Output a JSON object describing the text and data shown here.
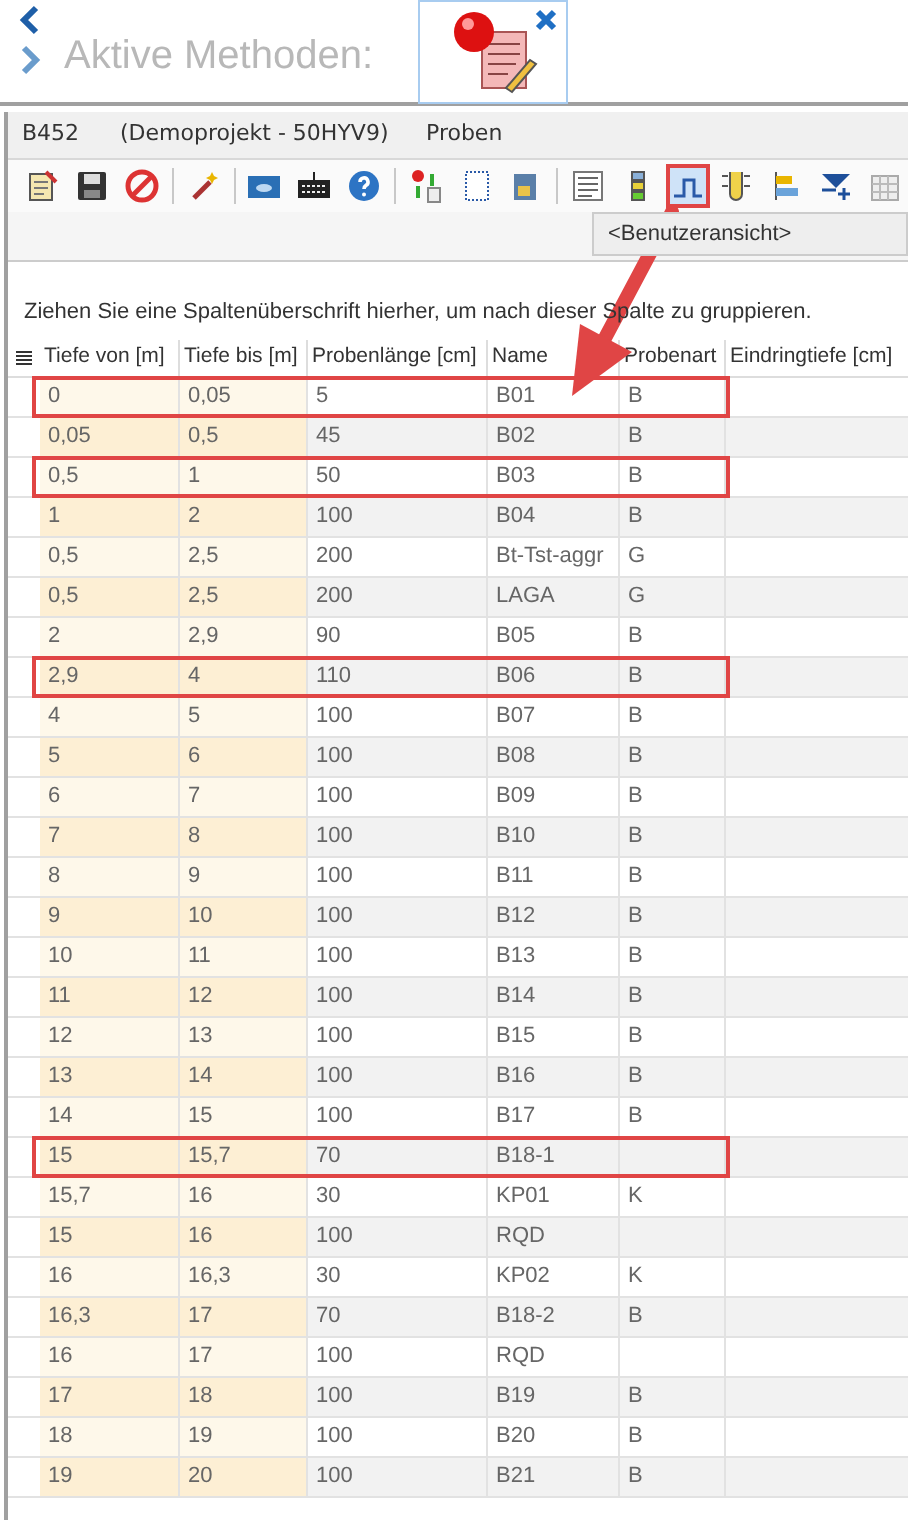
{
  "header": {
    "title": "Aktive Methoden:"
  },
  "info_bar": {
    "id": "B452",
    "project": "(Demoprojekt - 50HYV9)",
    "section": "Proben"
  },
  "toolbar": {
    "buttons": [
      {
        "kind": "notepad",
        "selected": false,
        "highlighted": false
      },
      {
        "kind": "save",
        "selected": false,
        "highlighted": false
      },
      {
        "kind": "cancel",
        "selected": false,
        "highlighted": false
      },
      {
        "kind": "sep"
      },
      {
        "kind": "wand",
        "selected": false,
        "highlighted": false
      },
      {
        "kind": "sep"
      },
      {
        "kind": "monitor",
        "selected": false,
        "highlighted": false
      },
      {
        "kind": "keyboard",
        "selected": false,
        "highlighted": false
      },
      {
        "kind": "help",
        "selected": false,
        "highlighted": false
      },
      {
        "kind": "sep"
      },
      {
        "kind": "transfer",
        "selected": false,
        "highlighted": false
      },
      {
        "kind": "page",
        "selected": false,
        "highlighted": false
      },
      {
        "kind": "book",
        "selected": false,
        "highlighted": false
      },
      {
        "kind": "sep"
      },
      {
        "kind": "list",
        "selected": false,
        "highlighted": false
      },
      {
        "kind": "bars",
        "selected": false,
        "highlighted": false
      },
      {
        "kind": "profile",
        "selected": true,
        "highlighted": true
      },
      {
        "kind": "tube",
        "selected": false,
        "highlighted": false
      },
      {
        "kind": "align",
        "selected": false,
        "highlighted": false
      },
      {
        "kind": "filter",
        "selected": false,
        "highlighted": false
      },
      {
        "kind": "grid",
        "selected": false,
        "highlighted": false
      }
    ]
  },
  "view_select": {
    "value": "<Benutzeransicht>"
  },
  "group_hint": "Ziehen Sie eine Spaltenüberschrift hierher, um nach dieser Spalte zu gruppieren.",
  "table": {
    "columns": [
      "Tiefe von [m]",
      "Tiefe bis [m]",
      "Probenlänge [cm]",
      "Name",
      "Probenart",
      "Eindringtiefe [cm]"
    ],
    "rows": [
      {
        "cells": [
          "0",
          "0,05",
          "5",
          "B01",
          "B"
        ],
        "highlighted": true
      },
      {
        "cells": [
          "0,05",
          "0,5",
          "45",
          "B02",
          "B"
        ],
        "highlighted": false
      },
      {
        "cells": [
          "0,5",
          "1",
          "50",
          "B03",
          "B"
        ],
        "highlighted": true
      },
      {
        "cells": [
          "1",
          "2",
          "100",
          "B04",
          "B"
        ],
        "highlighted": false
      },
      {
        "cells": [
          "0,5",
          "2,5",
          "200",
          "Bt-Tst-aggr",
          "G"
        ],
        "highlighted": false
      },
      {
        "cells": [
          "0,5",
          "2,5",
          "200",
          "LAGA",
          "G"
        ],
        "highlighted": false
      },
      {
        "cells": [
          "2",
          "2,9",
          "90",
          "B05",
          "B"
        ],
        "highlighted": false
      },
      {
        "cells": [
          "2,9",
          "4",
          "110",
          "B06",
          "B"
        ],
        "highlighted": true
      },
      {
        "cells": [
          "4",
          "5",
          "100",
          "B07",
          "B"
        ],
        "highlighted": false
      },
      {
        "cells": [
          "5",
          "6",
          "100",
          "B08",
          "B"
        ],
        "highlighted": false
      },
      {
        "cells": [
          "6",
          "7",
          "100",
          "B09",
          "B"
        ],
        "highlighted": false
      },
      {
        "cells": [
          "7",
          "8",
          "100",
          "B10",
          "B"
        ],
        "highlighted": false
      },
      {
        "cells": [
          "8",
          "9",
          "100",
          "B11",
          "B"
        ],
        "highlighted": false
      },
      {
        "cells": [
          "9",
          "10",
          "100",
          "B12",
          "B"
        ],
        "highlighted": false
      },
      {
        "cells": [
          "10",
          "11",
          "100",
          "B13",
          "B"
        ],
        "highlighted": false
      },
      {
        "cells": [
          "11",
          "12",
          "100",
          "B14",
          "B"
        ],
        "highlighted": false
      },
      {
        "cells": [
          "12",
          "13",
          "100",
          "B15",
          "B"
        ],
        "highlighted": false
      },
      {
        "cells": [
          "13",
          "14",
          "100",
          "B16",
          "B"
        ],
        "highlighted": false
      },
      {
        "cells": [
          "14",
          "15",
          "100",
          "B17",
          "B"
        ],
        "highlighted": false
      },
      {
        "cells": [
          "15",
          "15,7",
          "70",
          "B18-1"
        ],
        "highlighted": true
      },
      {
        "cells": [
          "15,7",
          "16",
          "30",
          "KP01",
          "K"
        ],
        "highlighted": false
      },
      {
        "cells": [
          "15",
          "16",
          "100",
          "RQD"
        ],
        "highlighted": false
      },
      {
        "cells": [
          "16",
          "16,3",
          "30",
          "KP02",
          "K"
        ],
        "highlighted": false
      },
      {
        "cells": [
          "16,3",
          "17",
          "70",
          "B18-2",
          "B"
        ],
        "highlighted": false
      },
      {
        "cells": [
          "16",
          "17",
          "100",
          "RQD"
        ],
        "highlighted": false
      },
      {
        "cells": [
          "17",
          "18",
          "100",
          "B19",
          "B"
        ],
        "highlighted": false
      },
      {
        "cells": [
          "18",
          "19",
          "100",
          "B20",
          "B"
        ],
        "highlighted": false
      },
      {
        "cells": [
          "19",
          "20",
          "100",
          "B21",
          "B"
        ],
        "highlighted": false
      }
    ]
  }
}
